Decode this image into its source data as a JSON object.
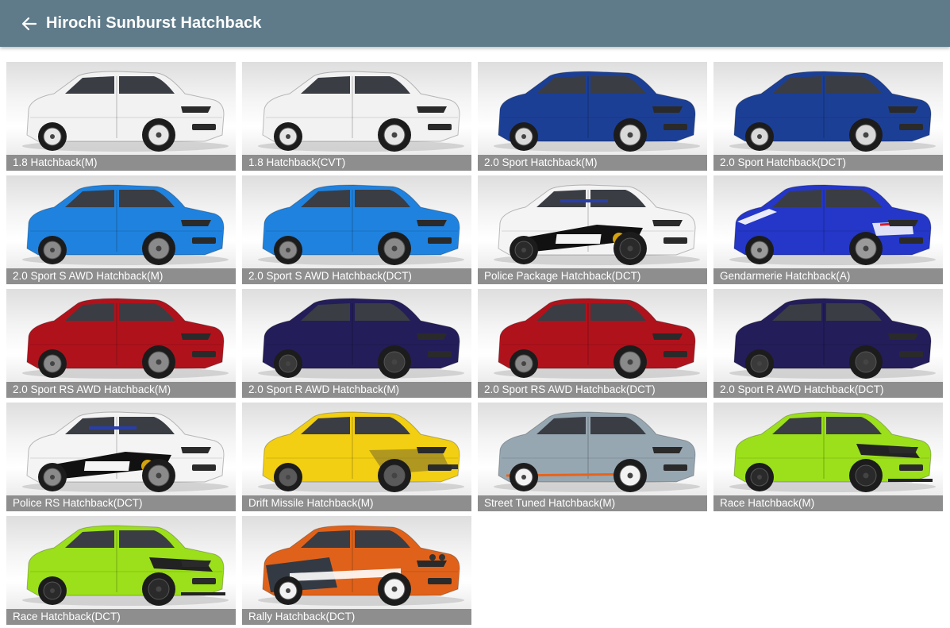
{
  "header": {
    "title": "Hirochi Sunburst Hatchback",
    "back_icon": "arrow-left-icon"
  },
  "configs": [
    {
      "label": "1.8 Hatchback(M)",
      "body": "#f2f2f2",
      "accent": "#d8d8d8",
      "wheel": "#e6e6e6",
      "livery": "none"
    },
    {
      "label": "1.8 Hatchback(CVT)",
      "body": "#f2f2f2",
      "accent": "#d8d8d8",
      "wheel": "#e6e6e6",
      "livery": "none"
    },
    {
      "label": "2.0 Sport Hatchback(M)",
      "body": "#1c3f96",
      "accent": "#14307a",
      "wheel": "#d9d9d9",
      "livery": "none"
    },
    {
      "label": "2.0 Sport Hatchback(DCT)",
      "body": "#1c3f96",
      "accent": "#14307a",
      "wheel": "#d9d9d9",
      "livery": "none"
    },
    {
      "label": "2.0 Sport S AWD Hatchback(M)",
      "body": "#1f82df",
      "accent": "#1668b8",
      "wheel": "#8a8a8a",
      "livery": "none"
    },
    {
      "label": "2.0 Sport S AWD Hatchback(DCT)",
      "body": "#1f82df",
      "accent": "#1668b8",
      "wheel": "#8a8a8a",
      "livery": "none"
    },
    {
      "label": "Police Package Hatchback(DCT)",
      "body": "#f4f4f4",
      "accent": "#1a1a1a",
      "wheel": "#2a2a2a",
      "livery": "police"
    },
    {
      "label": "Gendarmerie Hatchback(A)",
      "body": "#2437c8",
      "accent": "#1a2796",
      "wheel": "#9a9a9a",
      "livery": "gendarmerie"
    },
    {
      "label": "2.0 Sport RS AWD Hatchback(M)",
      "body": "#b0121c",
      "accent": "#8a0d15",
      "wheel": "#8a8a8a",
      "livery": "none"
    },
    {
      "label": "2.0 Sport R AWD Hatchback(M)",
      "body": "#231d5a",
      "accent": "#171242",
      "wheel": "#3a3a3a",
      "livery": "none"
    },
    {
      "label": "2.0 Sport RS AWD Hatchback(DCT)",
      "body": "#b0121c",
      "accent": "#8a0d15",
      "wheel": "#8a8a8a",
      "livery": "none"
    },
    {
      "label": "2.0 Sport R AWD Hatchback(DCT)",
      "body": "#231d5a",
      "accent": "#171242",
      "wheel": "#3a3a3a",
      "livery": "none"
    },
    {
      "label": "Police RS Hatchback(DCT)",
      "body": "#f4f4f4",
      "accent": "#1a1a1a",
      "wheel": "#8a8a8a",
      "livery": "police"
    },
    {
      "label": "Drift Missile Hatchback(M)",
      "body": "#f2cf12",
      "accent": "#c9a80c",
      "wheel": "#5a5a5a",
      "livery": "drift"
    },
    {
      "label": "Street Tuned Hatchback(M)",
      "body": "#97a7b2",
      "accent": "#e8631a",
      "wheel": "#f2f2f2",
      "livery": "street"
    },
    {
      "label": "Race Hatchback(M)",
      "body": "#9be01a",
      "accent": "#222222",
      "wheel": "#2a2a2a",
      "livery": "race"
    },
    {
      "label": "Race Hatchback(DCT)",
      "body": "#9be01a",
      "accent": "#222222",
      "wheel": "#2a2a2a",
      "livery": "race"
    },
    {
      "label": "Rally Hatchback(DCT)",
      "body": "#e0621a",
      "accent": "#333a44",
      "wheel": "#f2f2f2",
      "livery": "rally"
    }
  ]
}
